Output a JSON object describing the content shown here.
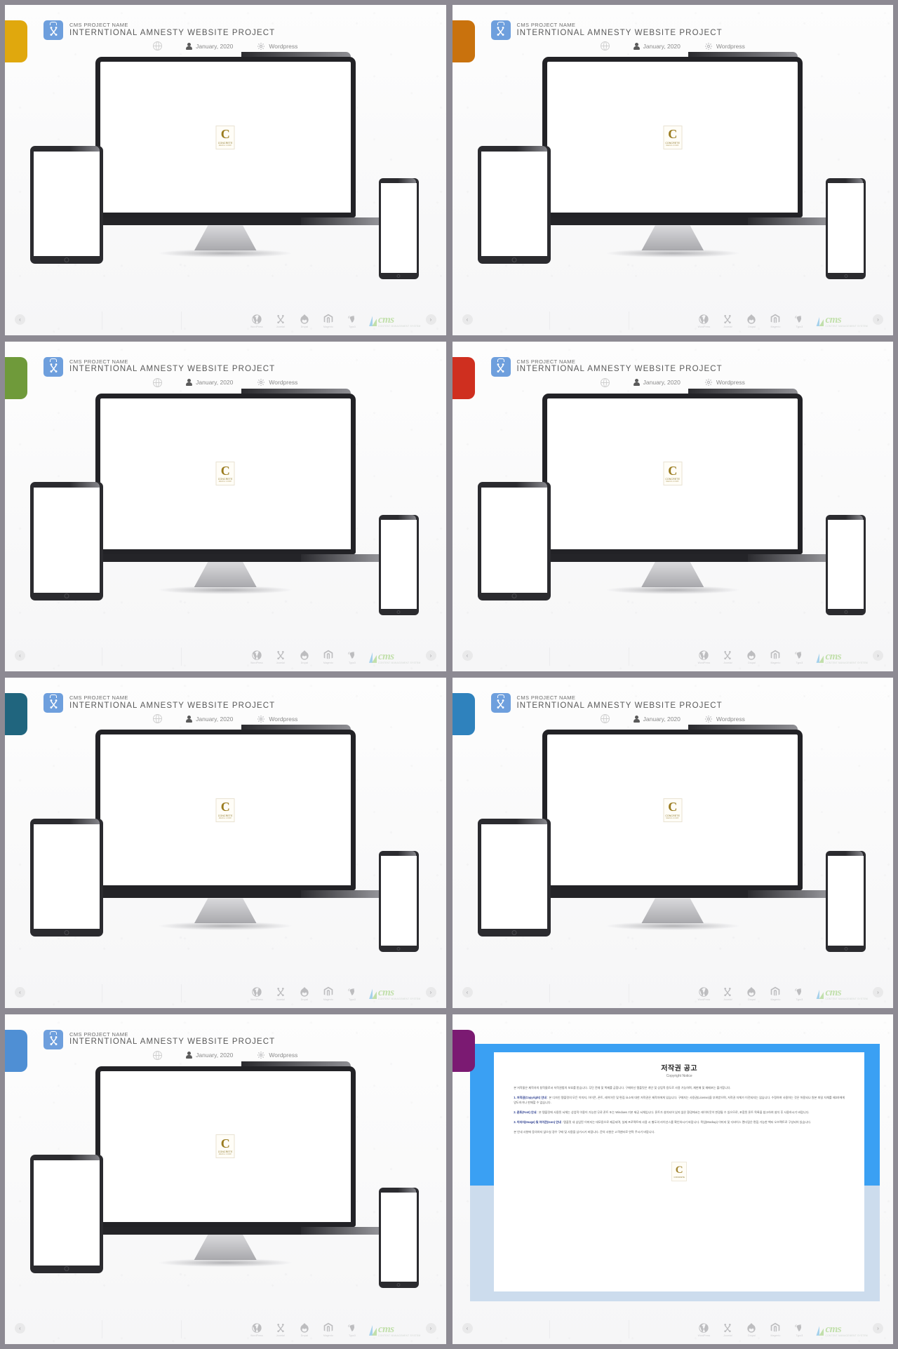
{
  "panels": [
    {
      "id": "panel-1",
      "bookmark_color": "#e0a80d",
      "kind": "mockup"
    },
    {
      "id": "panel-2",
      "bookmark_color": "#c9720d",
      "kind": "mockup"
    },
    {
      "id": "panel-3",
      "bookmark_color": "#6f9a3a",
      "kind": "mockup"
    },
    {
      "id": "panel-4",
      "bookmark_color": "#cf2f1f",
      "kind": "mockup"
    },
    {
      "id": "panel-5",
      "bookmark_color": "#20657e",
      "kind": "mockup"
    },
    {
      "id": "panel-6",
      "bookmark_color": "#2f82bd",
      "kind": "mockup"
    },
    {
      "id": "panel-7",
      "bookmark_color": "#4f8fd4",
      "kind": "mockup"
    },
    {
      "id": "panel-8",
      "bookmark_color": "#7b1a72",
      "kind": "copyright"
    }
  ],
  "slide": {
    "icon_name": "joomla-briefcase-icon",
    "eyebrow": "CMS PROJECT NAME",
    "title": "INTERNTIONAL AMNESTY WEBSITE PROJECT",
    "meta": {
      "globe_icon": "globe-icon",
      "person_icon": "person-icon",
      "date": "January, 2020",
      "gear_icon": "gear-icon",
      "platform": "Wordpress"
    },
    "screen_logo": {
      "letter": "C",
      "sub": "CONCRETE",
      "sub2": "MEDIA  CORP."
    },
    "nav": {
      "prev": "‹",
      "next": "›"
    },
    "footer_cms": [
      {
        "name": "WordPress",
        "icon": "wordpress-icon"
      },
      {
        "name": "Joomla!",
        "icon": "joomla-icon"
      },
      {
        "name": "Drupal",
        "icon": "drupal-icon"
      },
      {
        "name": "Magento",
        "icon": "magento-icon"
      },
      {
        "name": "Typo3",
        "icon": "typo3-icon"
      }
    ],
    "brand": {
      "word": "cms",
      "tagline": "CONTENT MANAGEMENT SYSTEM"
    }
  },
  "copyright": {
    "title": "저작권 공고",
    "subtitle": "Copyright Notice",
    "intro": "본 저작물은 제작자의 창작물로서 저작권법의 보호를 받습니다. 무단 전재 및 복제를 금합니다. 구매하신 템플릿은 개인 및 상업적 용도로 사용 가능하며, 재판매 및 재배포는 불가합니다.",
    "sections": [
      {
        "heading": "1. 저작권(Copyright) 안내",
        "body": "본 디자인 템플릿의 모든 이미지, 아이콘, 폰트, 레이아웃 및 편집 요소에 대한 저작권은 제작자에게 있습니다. 구매자는 사용권(License)을 부여받으며, 저작권 자체가 이전되지는 않습니다. 수정하여 사용하는 것은 허용되나 원본 파일 자체를 제3자에게 양도하거나 판매할 수 없습니다."
      },
      {
        "heading": "2. 폰트(Font) 안내",
        "body": "본 템플릿에 사용된 서체는 상업적 이용이 가능한 무료 폰트 또는 Windows 기본 제공 서체입니다. 폰트가 설치되어 있지 않은 환경에서는 레이아웃이 변경될 수 있으므로, 포함된 폰트 목록을 참고하여 설치 후 사용하시기 바랍니다."
      },
      {
        "heading": "3. 이미지(Image) 및 아이콘(Icon) 안내",
        "body": "템플릿 내 삽입된 이미지는 데모용으로 제공되며, 실제 프로젝트에 사용 시 별도의 라이선스를 확인하시기 바랍니다. 목업(Mockup) 이미지 및 디바이스 렌더링은 편집 가능한 벡터 오브젝트로 구성되어 있습니다."
      },
      {
        "heading": "",
        "body": "본 안내 사항에 동의하지 않으실 경우 구매 및 사용을 삼가시기 바랍니다. 문의 사항은 고객센터로 연락 주시기 바랍니다."
      }
    ],
    "watermark": {
      "letter": "C",
      "sub": "CONCRETE"
    }
  }
}
